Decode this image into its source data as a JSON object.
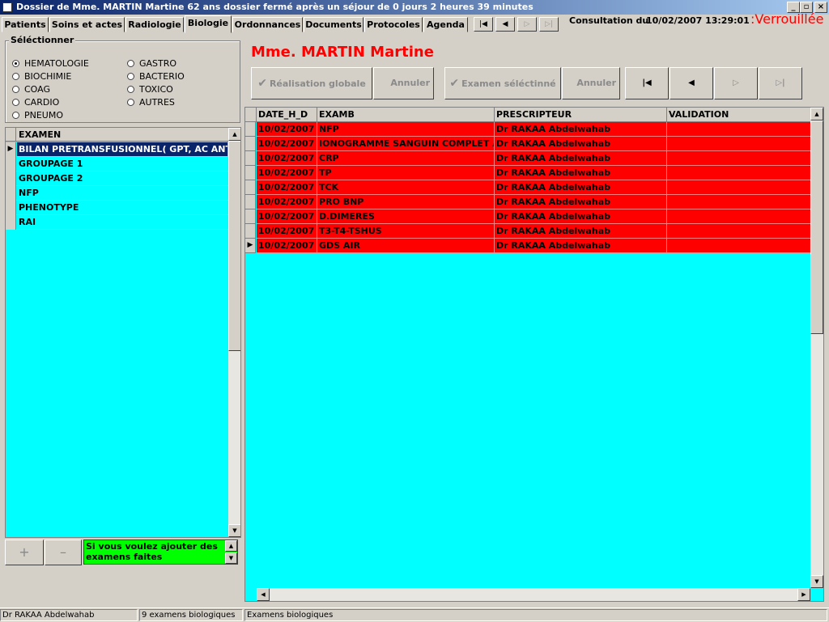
{
  "window": {
    "title": "Dossier de Mme. MARTIN Martine     62 ans  dossier fermé après un séjour de 0 jours 2 heures 39 minutes",
    "buttons": [
      "_",
      "▫",
      "×"
    ]
  },
  "tabs": [
    "Patients",
    "Soins et actes",
    "Radiologie",
    "Biologie",
    "Ordonnances",
    "Documents",
    "Protocoles",
    "Agenda"
  ],
  "active_tab": "Biologie",
  "consultation": {
    "label": "Consultation du",
    "datetime": "10/02/2007 13:29:01",
    "status": ":Verrouillée",
    "status_color": "#ff0000"
  },
  "select_group": {
    "label": "Séléctionner",
    "options": [
      "HEMATOLOGIE",
      "BIOCHIMIE",
      "COAG",
      "CARDIO",
      "PNEUMO",
      "GASTRO",
      "BACTERIO",
      "TOXICO",
      "AUTRES"
    ],
    "selected": "HEMATOLOGIE"
  },
  "exam_list": {
    "header": "EXAMEN",
    "items": [
      "BILAN PRETRANSFUSIONNEL( GPT, AC ANTI",
      "GROUPAGE 1",
      "GROUPAGE 2",
      "NFP",
      "PHENOTYPE",
      "RAI"
    ],
    "selected_index": 0,
    "background": "#00ffff"
  },
  "left_buttons": {
    "add": "+",
    "remove": "–"
  },
  "info_box": {
    "text": "Si vous voulez ajouter des examens faites",
    "background": "#00ff00"
  },
  "patient": {
    "name": "Mme. MARTIN Martine",
    "color": "#ff0000"
  },
  "toolbar": {
    "realisation_globale": "Réalisation globale",
    "annuler_1": "Annuler",
    "examen_selectionne": "Examen séléctinné",
    "annuler_2": "Annuler"
  },
  "grid": {
    "columns": [
      "DATE_H_D",
      "EXAMB",
      "PRESCRIPTEUR",
      "VALIDATION"
    ],
    "rows": [
      [
        "10/02/2007",
        "NFP",
        "Dr RAKAA Abdelwahab",
        ""
      ],
      [
        "10/02/2007",
        "IONOGRAMME SANGUIN COMPLET A",
        "Dr RAKAA Abdelwahab",
        ""
      ],
      [
        "10/02/2007",
        "CRP",
        "Dr RAKAA Abdelwahab",
        ""
      ],
      [
        "10/02/2007",
        "TP",
        "Dr RAKAA Abdelwahab",
        ""
      ],
      [
        "10/02/2007",
        "TCK",
        "Dr RAKAA Abdelwahab",
        ""
      ],
      [
        "10/02/2007",
        "PRO BNP",
        "Dr RAKAA Abdelwahab",
        ""
      ],
      [
        "10/02/2007",
        "D.DIMERES",
        "Dr RAKAA Abdelwahab",
        ""
      ],
      [
        "10/02/2007",
        "T3-T4-TSHUS",
        "Dr RAKAA Abdelwahab",
        ""
      ],
      [
        "10/02/2007",
        "GDS AIR",
        "Dr RAKAA Abdelwahab",
        ""
      ]
    ],
    "current_row_index": 8,
    "row_color": "#ff0000",
    "background": "#00ffff"
  },
  "statusbar": [
    "Dr RAKAA Abdelwahab",
    "9 examens biologiques",
    "Examens biologiques"
  ],
  "icons": {
    "first": "first-record-icon",
    "prev": "previous-record-icon",
    "next": "next-record-icon",
    "last": "last-record-icon",
    "check": "checkmark-icon",
    "row_pointer": "row-pointer-icon"
  }
}
